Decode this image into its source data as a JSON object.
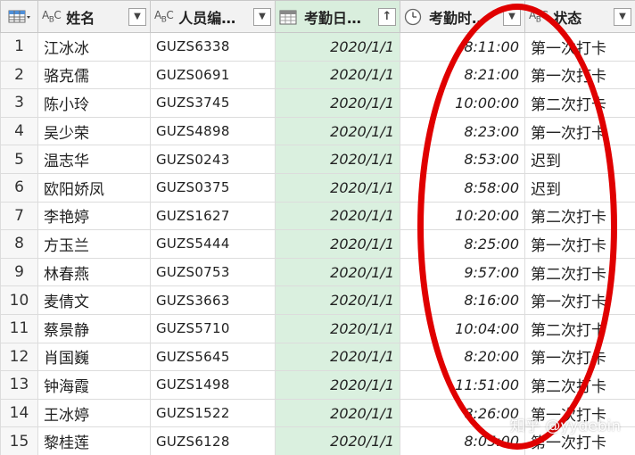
{
  "columns": [
    {
      "type_icon": "ABC",
      "label": "姓名",
      "dropdown": "▼"
    },
    {
      "type_icon": "ABC",
      "label": "人员编…",
      "dropdown": "▼"
    },
    {
      "type_icon": "calendar",
      "label": "考勤日…",
      "dropdown": "↑"
    },
    {
      "type_icon": "clock",
      "label": "考勤时…",
      "dropdown": "▼"
    },
    {
      "type_icon": "ABC",
      "label": "状态",
      "dropdown": "▼"
    }
  ],
  "rows": [
    {
      "n": "1",
      "name": "江冰冰",
      "code": "GUZS6338",
      "date": "2020/1/1",
      "time": "8:11:00",
      "status": "第一次打卡"
    },
    {
      "n": "2",
      "name": "骆克儒",
      "code": "GUZS0691",
      "date": "2020/1/1",
      "time": "8:21:00",
      "status": "第一次打卡"
    },
    {
      "n": "3",
      "name": "陈小玲",
      "code": "GUZS3745",
      "date": "2020/1/1",
      "time": "10:00:00",
      "status": "第二次打卡"
    },
    {
      "n": "4",
      "name": "吴少荣",
      "code": "GUZS4898",
      "date": "2020/1/1",
      "time": "8:23:00",
      "status": "第一次打卡"
    },
    {
      "n": "5",
      "name": "温志华",
      "code": "GUZS0243",
      "date": "2020/1/1",
      "time": "8:53:00",
      "status": "迟到"
    },
    {
      "n": "6",
      "name": "欧阳娇凤",
      "code": "GUZS0375",
      "date": "2020/1/1",
      "time": "8:58:00",
      "status": "迟到"
    },
    {
      "n": "7",
      "name": "李艳婷",
      "code": "GUZS1627",
      "date": "2020/1/1",
      "time": "10:20:00",
      "status": "第二次打卡"
    },
    {
      "n": "8",
      "name": "方玉兰",
      "code": "GUZS5444",
      "date": "2020/1/1",
      "time": "8:25:00",
      "status": "第一次打卡"
    },
    {
      "n": "9",
      "name": "林春燕",
      "code": "GUZS0753",
      "date": "2020/1/1",
      "time": "9:57:00",
      "status": "第二次打卡"
    },
    {
      "n": "10",
      "name": "麦倩文",
      "code": "GUZS3663",
      "date": "2020/1/1",
      "time": "8:16:00",
      "status": "第一次打卡"
    },
    {
      "n": "11",
      "name": "蔡景静",
      "code": "GUZS5710",
      "date": "2020/1/1",
      "time": "10:04:00",
      "status": "第二次打卡"
    },
    {
      "n": "12",
      "name": "肖国巍",
      "code": "GUZS5645",
      "date": "2020/1/1",
      "time": "8:20:00",
      "status": "第一次打卡"
    },
    {
      "n": "13",
      "name": "钟海霞",
      "code": "GUZS1498",
      "date": "2020/1/1",
      "time": "11:51:00",
      "status": "第二次打卡"
    },
    {
      "n": "14",
      "name": "王冰婷",
      "code": "GUZS1522",
      "date": "2020/1/1",
      "time": "8:26:00",
      "status": "第一次打卡"
    },
    {
      "n": "15",
      "name": "黎桂莲",
      "code": "GUZS6128",
      "date": "2020/1/1",
      "time": "8:05:00",
      "status": "第一次打卡"
    }
  ],
  "watermark": "知乎 @yydebin",
  "colors": {
    "accent_column": "#daf0df",
    "annotation": "#e00000"
  }
}
